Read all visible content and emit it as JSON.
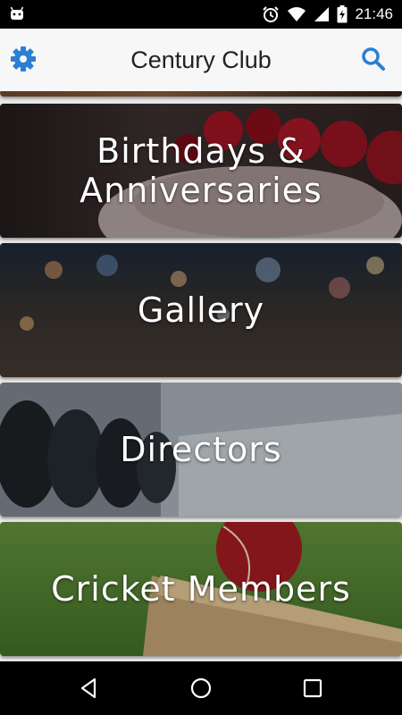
{
  "status_bar": {
    "time": "21:46",
    "icons": [
      "android-icon",
      "alarm-icon",
      "wifi-icon",
      "signal-icon",
      "battery-charging-icon"
    ]
  },
  "app_bar": {
    "title": "Century Club",
    "left_icon": "gear-icon",
    "right_icon": "search-icon",
    "accent_color": "#2a7fd4"
  },
  "menu": {
    "items": [
      {
        "label": "Birthdays & Anniversaries",
        "line1": "Birthdays &",
        "line2": "Anniversaries",
        "image": "cake-photo"
      },
      {
        "label": "Gallery",
        "image": "night-city-bokeh-photo"
      },
      {
        "label": "Directors",
        "image": "boardroom-chairs-photo"
      },
      {
        "label": "Cricket Members",
        "image": "cricket-ball-and-bat-photo"
      }
    ]
  },
  "nav_bar": {
    "buttons": [
      "back-icon",
      "home-icon",
      "recents-icon"
    ]
  }
}
